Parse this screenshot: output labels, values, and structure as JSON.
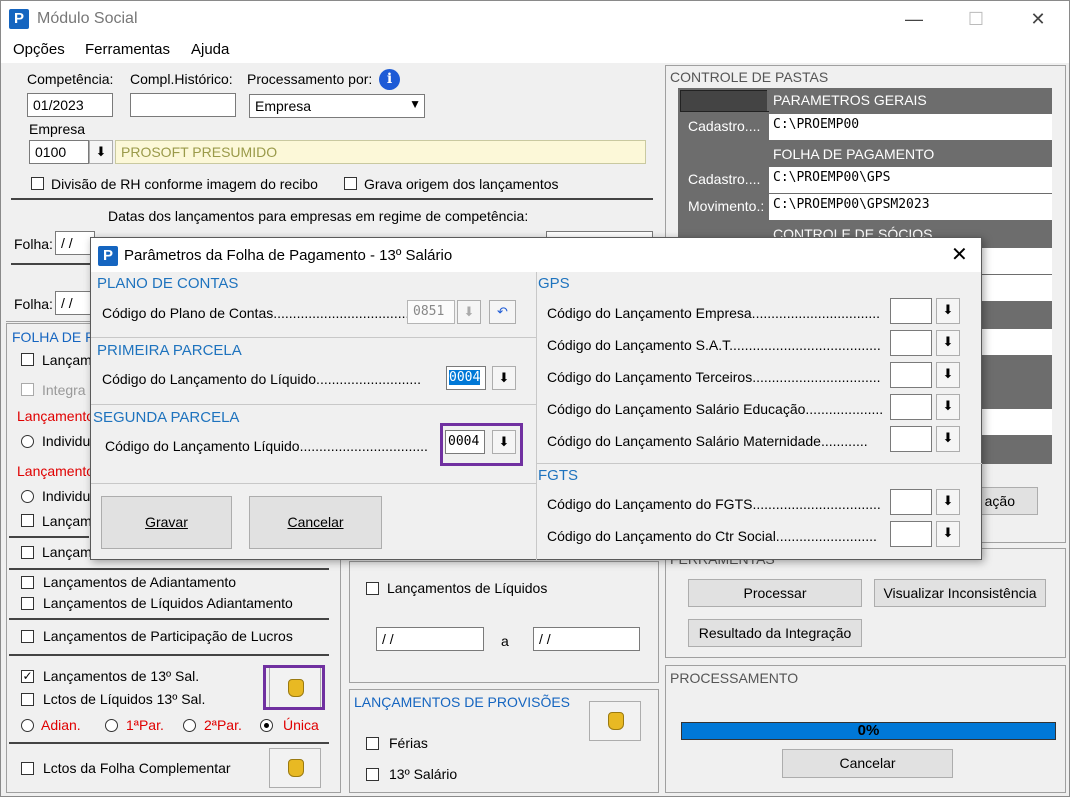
{
  "window": {
    "title": "Módulo Social",
    "minimize": "—",
    "maximize": "☐",
    "close": "✕"
  },
  "menu": [
    "Opções",
    "Ferramentas",
    "Ajuda"
  ],
  "top": {
    "competencia_label": "Competência:",
    "competencia": "01/2023",
    "compl_label": "Compl.Histórico:",
    "compl": "",
    "proc_label": "Processamento por:",
    "proc": "Empresa",
    "empresa_label": "Empresa",
    "empresa_code": "0100",
    "empresa_name": "PROSOFT PRESUMIDO",
    "chk_rh": "Divisão de RH conforme imagem do recibo",
    "chk_origem": "Grava origem dos lançamentos",
    "datas_label": "Datas dos lançamentos para empresas em regime de competência:",
    "folha_label": "Folha:",
    "date_placeholder": "/ /"
  },
  "pastas": {
    "title": "CONTROLE DE PASTAS",
    "param_gerais": "PARAMETROS GERAIS",
    "cadastro_label": "Cadastro....",
    "cadastro1": "C:\\PROEMP00",
    "folha_pag": "FOLHA DE PAGAMENTO",
    "cadastro2": "C:\\PROEMP00\\GPS",
    "movimento_label": "Movimento.:",
    "movimento": "C:\\PROEMP00\\GPSM2023",
    "socios": "CONTROLE DE SÓCIOS",
    "integracao_btn": "ação"
  },
  "left": {
    "folha_title": "FOLHA DE PA",
    "lanc_a": "Lançam",
    "integr": "Integra",
    "lancamento_red1": "Lançamento",
    "individ1": "Individu",
    "lancamento_red2": "Lançamento",
    "individ2": "Individu",
    "lanc_b": "Lançam",
    "lanc_c": "Lançam",
    "adiantamento": "Lançamentos de Adiantamento",
    "liq_adiant": "Lançamentos de Líquidos Adiantamento",
    "part_lucros": "Lançamentos de Participação de Lucros",
    "decimo": "Lançamentos de 13º Sal.",
    "liq_decimo": "Lctos de Líquidos 13º Sal.",
    "r_adian": "Adian.",
    "r_1par": "1ªPar.",
    "r_2par": "2ªPar.",
    "r_unica": "Única",
    "complementar": "Lctos da Folha Complementar"
  },
  "mid": {
    "liquidos": "Lançamentos de Líquidos",
    "date_from": "/ /",
    "a": "a",
    "date_to": "/ /",
    "provisoes_title": "LANÇAMENTOS DE PROVISÕES",
    "ferias": "Férias",
    "decimo": "13º Salário"
  },
  "ferramentas": {
    "title": "FERRAMENTAS",
    "processar": "Processar",
    "inconsistencia": "Visualizar Inconsistência",
    "resultado": "Resultado da Integração"
  },
  "processamento": {
    "title": "PROCESSAMENTO",
    "progress_text": "0%",
    "progress": 0,
    "cancelar": "Cancelar"
  },
  "dialog": {
    "title": "Parâmetros da Folha de Pagamento - 13º Salário",
    "plano_title": "PLANO DE CONTAS",
    "plano_label": "Código do Plano de Contas....................................",
    "plano_value": "0851",
    "primeira_title": "PRIMEIRA PARCELA",
    "primeira_label": "Código do Lançamento do Líquido...........................",
    "primeira_value": "0004",
    "segunda_title": "SEGUNDA PARCELA",
    "segunda_label": "Código do Lançamento Líquido.................................",
    "segunda_value": "0004",
    "gravar": "Gravar",
    "cancelar": "Cancelar",
    "gps_title": "GPS",
    "gps_rows": [
      "Código do Lançamento Empresa.................................",
      "Código do Lançamento S.A.T.......................................",
      "Código do Lançamento Terceiros.................................",
      "Código do Lançamento Salário Educação....................",
      "Código do Lançamento Salário Maternidade............"
    ],
    "fgts_title": "FGTS",
    "fgts_rows": [
      "Código do Lançamento do FGTS.................................",
      "Código do Lançamento do Ctr Social.........................."
    ]
  },
  "colors": {
    "highlight": "#7030a0",
    "accent": "#1565c0",
    "progress": "#0078d7"
  }
}
